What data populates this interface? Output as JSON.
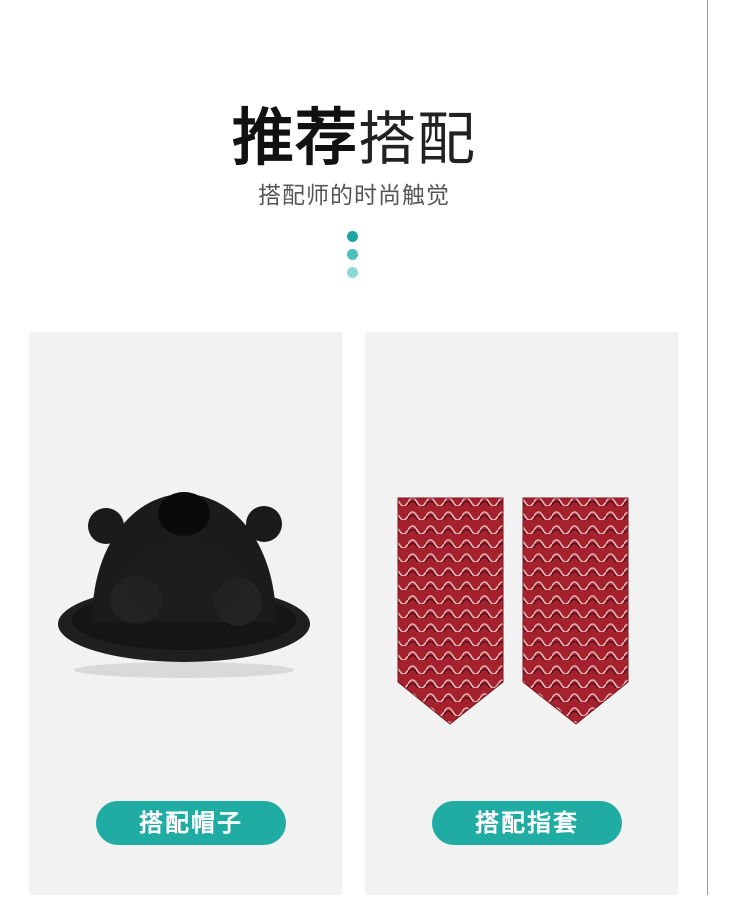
{
  "header": {
    "title_bold": "推荐",
    "title_light": "搭配",
    "subtitle": "搭配师的时尚触觉"
  },
  "cards": [
    {
      "label": "搭配帽子",
      "product_icon": "hat-icon"
    },
    {
      "label": "搭配指套",
      "product_icon": "cuffs-icon"
    }
  ],
  "colors": {
    "accent": "#21aca3",
    "card_bg": "#f2f2f2",
    "dot1": "#1aa7a1",
    "dot2": "#49c2bc",
    "dot3": "#8ad9d4"
  }
}
